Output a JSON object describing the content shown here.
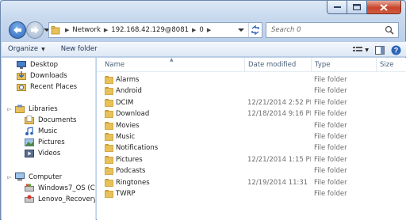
{
  "window": {
    "caption_buttons": [
      "minimize",
      "maximize",
      "close"
    ]
  },
  "address_bar": {
    "segments": [
      "Network",
      "192.168.42.129@8081",
      "0"
    ]
  },
  "search": {
    "placeholder": "Search 0"
  },
  "toolbar": {
    "organize_label": "Organize",
    "new_folder_label": "New folder"
  },
  "nav_pane": {
    "favorites": [
      {
        "label": "Desktop",
        "icon": "desktop-icon"
      },
      {
        "label": "Downloads",
        "icon": "downloads-icon"
      },
      {
        "label": "Recent Places",
        "icon": "recent-places-icon"
      }
    ],
    "libraries": {
      "label": "Libraries",
      "items": [
        {
          "label": "Documents",
          "icon": "documents-icon"
        },
        {
          "label": "Music",
          "icon": "music-icon"
        },
        {
          "label": "Pictures",
          "icon": "pictures-icon"
        },
        {
          "label": "Videos",
          "icon": "videos-icon"
        }
      ]
    },
    "computer": {
      "label": "Computer",
      "items": [
        {
          "label": "Windows7_OS (C",
          "icon": "drive-icon"
        },
        {
          "label": "Lenovo_Recovery",
          "icon": "recovery-drive-icon"
        }
      ]
    }
  },
  "columns": {
    "name": "Name",
    "date": "Date modified",
    "type": "Type",
    "size": "Size"
  },
  "files": [
    {
      "name": "Alarms",
      "date": "",
      "type": "File folder"
    },
    {
      "name": "Android",
      "date": "",
      "type": "File folder"
    },
    {
      "name": "DCIM",
      "date": "12/21/2014 2:52 PM",
      "type": "File folder"
    },
    {
      "name": "Download",
      "date": "12/18/2014 9:16 PM",
      "type": "File folder"
    },
    {
      "name": "Movies",
      "date": "",
      "type": "File folder"
    },
    {
      "name": "Music",
      "date": "",
      "type": "File folder"
    },
    {
      "name": "Notifications",
      "date": "",
      "type": "File folder"
    },
    {
      "name": "Pictures",
      "date": "12/21/2014 1:15 PM",
      "type": "File folder"
    },
    {
      "name": "Podcasts",
      "date": "",
      "type": "File folder"
    },
    {
      "name": "Ringtones",
      "date": "12/19/2014 11:31 ...",
      "type": "File folder"
    },
    {
      "name": "TWRP",
      "date": "",
      "type": "File folder"
    }
  ],
  "colors": {
    "folder": "#e8c15a",
    "folder_dark": "#c99b2e",
    "accent": "#2c64b8"
  }
}
